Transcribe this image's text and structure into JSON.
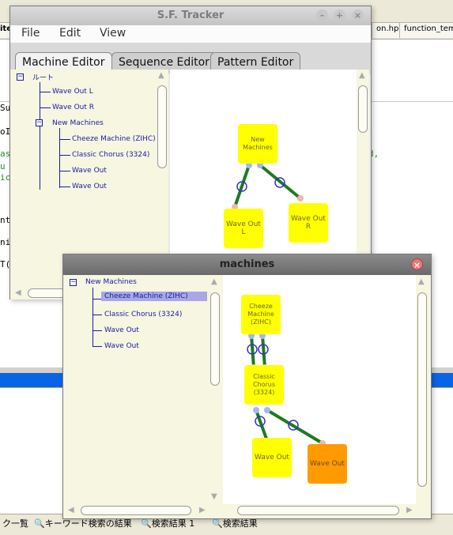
{
  "background_ide": {
    "tabs": [
      {
        "label": "ite"
      },
      {
        "label": "on.hpp"
      },
      {
        "label": "function_tem"
      }
    ],
    "code_fragments_left": [
      "Su",
      "oI",
      "as",
      "u",
      "ic",
      "nt",
      "ni",
      "T("
    ],
    "code_fragment_right": "d,",
    "bottom_tabs": [
      {
        "label": "ク一覧"
      },
      {
        "label": "キーワード検索の結果"
      },
      {
        "label": "検索結果 1"
      },
      {
        "label": "検索結果"
      }
    ]
  },
  "tracker_window": {
    "title": "S.F. Tracker",
    "menu": [
      {
        "label": "File"
      },
      {
        "label": "Edit"
      },
      {
        "label": "View"
      }
    ],
    "tabs": [
      {
        "label": "Machine Editor",
        "active": true
      },
      {
        "label": "Sequence Editor",
        "active": false
      },
      {
        "label": "Pattern Editor",
        "active": false
      }
    ],
    "tree": {
      "root": "ルート",
      "items": [
        {
          "label": "Wave Out L"
        },
        {
          "label": "Wave Out R"
        },
        {
          "label": "New Machines"
        },
        {
          "label": "Cheeze Machine (ZIHC)"
        },
        {
          "label": "Classic Chorus (3324)"
        },
        {
          "label": "Wave Out"
        },
        {
          "label": "Wave Out"
        }
      ]
    },
    "graph_nodes": [
      {
        "label": "New Machines"
      },
      {
        "label": "Wave Out L"
      },
      {
        "label": "Wave Out R"
      }
    ]
  },
  "machines_window": {
    "title": "machines",
    "tree": {
      "root": "New Machines",
      "items": [
        {
          "label": "Cheeze Machine (ZIHC)",
          "selected": true
        },
        {
          "label": "Classic Chorus (3324)"
        },
        {
          "label": "Wave Out"
        },
        {
          "label": "Wave Out"
        }
      ]
    },
    "graph_nodes": [
      {
        "label": "Cheeze Machine (ZIHC)"
      },
      {
        "label": "Classic Chorus (3324)"
      },
      {
        "label": "Wave Out"
      },
      {
        "label": "Wave Out"
      }
    ]
  },
  "colors": {
    "node_yellow": "#ffff00",
    "node_orange": "#ff9a00",
    "connection_green": "#1e7a1e",
    "tree_text": "#1a1aa6",
    "tree_bg": "#f6f6e1",
    "selection": "#a8a8e6"
  }
}
